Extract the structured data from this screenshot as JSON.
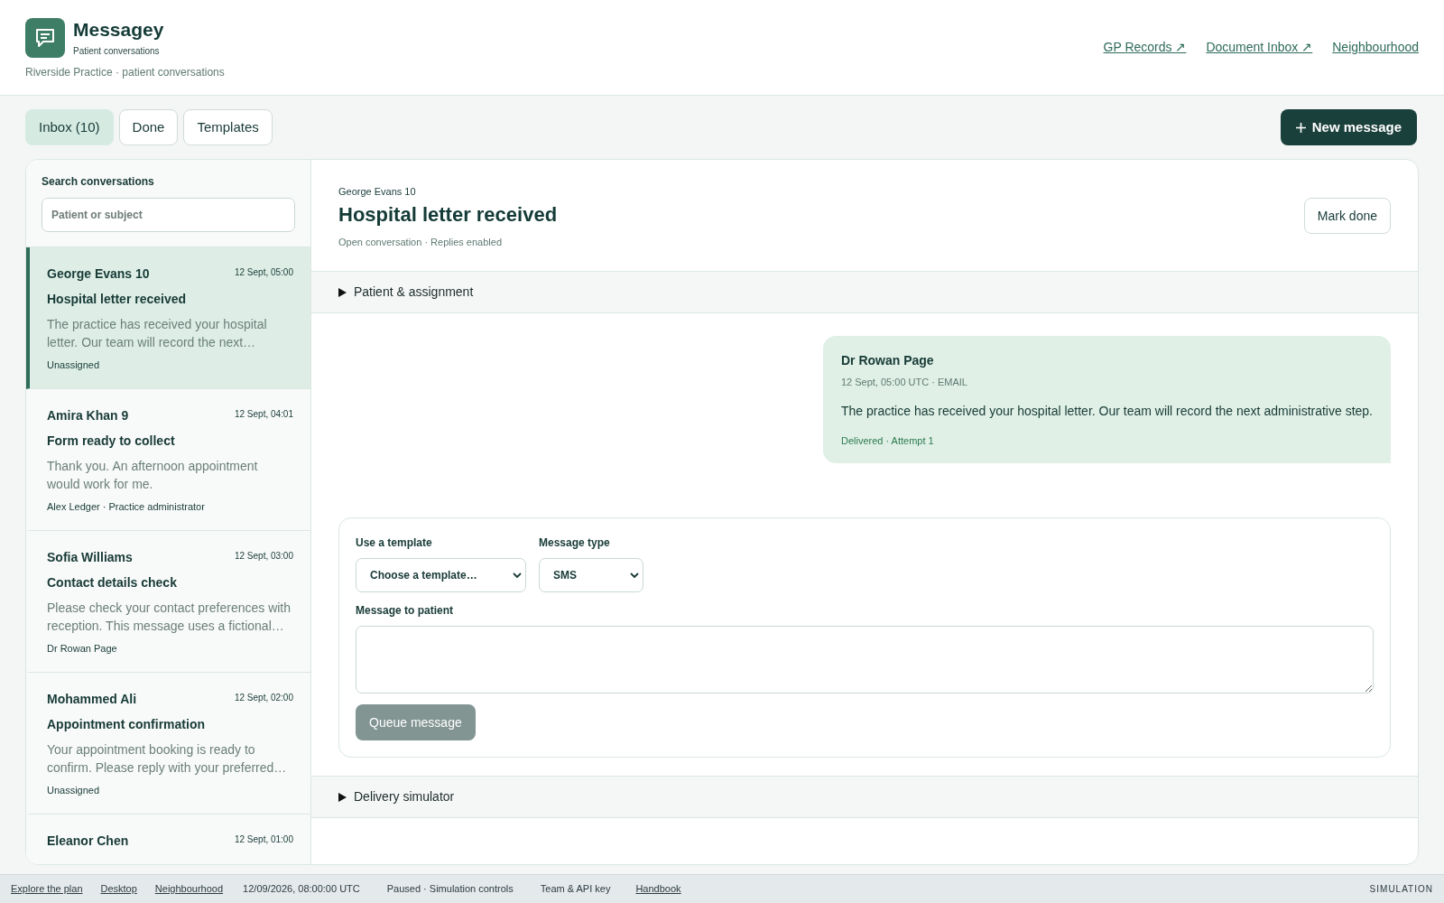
{
  "app": {
    "name": "Messagey",
    "tagline": "Patient conversations",
    "practice": "Riverside Practice · patient conversations"
  },
  "header_links": [
    "GP Records ↗",
    "Document Inbox ↗",
    "Neighbourhood"
  ],
  "tabs": [
    {
      "label": "Inbox (10)",
      "selected": true
    },
    {
      "label": "Done",
      "selected": false
    },
    {
      "label": "Templates",
      "selected": false
    }
  ],
  "new_message_button": "New message",
  "search": {
    "label": "Search conversations",
    "placeholder": "Patient or subject"
  },
  "conversations": [
    {
      "patient": "George Evans 10",
      "time": "12 Sept, 05:00",
      "subject": "Hospital letter received",
      "preview": "The practice has received your hospital letter. Our team will record the next…",
      "assignee": "Unassigned",
      "selected": true
    },
    {
      "patient": "Amira Khan 9",
      "time": "12 Sept, 04:01",
      "subject": "Form ready to collect",
      "preview": "Thank you. An afternoon appointment would work for me.",
      "assignee": "Alex Ledger · Practice administrator",
      "selected": false
    },
    {
      "patient": "Sofia Williams",
      "time": "12 Sept, 03:00",
      "subject": "Contact details check",
      "preview": "Please check your contact preferences with reception. This message uses a fictional…",
      "assignee": "Dr Rowan Page",
      "selected": false
    },
    {
      "patient": "Mohammed Ali",
      "time": "12 Sept, 02:00",
      "subject": "Appointment confirmation",
      "preview": "Your appointment booking is ready to confirm. Please reply with your preferred…",
      "assignee": "Unassigned",
      "selected": false
    },
    {
      "patient": "Eleanor Chen",
      "time": "12 Sept, 01:00",
      "selected": false
    }
  ],
  "conversation": {
    "patient": "George Evans 10",
    "title": "Hospital letter received",
    "status": "Open conversation · Replies enabled",
    "mark_done_button": "Mark done"
  },
  "patient_section": {
    "label": "Patient & assignment",
    "expanded": false
  },
  "messages": [
    {
      "sender": "Dr Rowan Page",
      "meta": "12 Sept, 05:00 UTC · EMAIL",
      "body": "The practice has received your hospital letter. Our team will record the next administrative step.",
      "status": "Delivered · Attempt 1"
    }
  ],
  "composer": {
    "template_label": "Use a template",
    "template_value": "Choose a template…",
    "type_label": "Message type",
    "type_value": "SMS",
    "message_label": "Message to patient",
    "send_button": {
      "label": "Queue message",
      "disabled": true
    }
  },
  "delivery_section": {
    "label": "Delivery simulator",
    "expanded": false
  },
  "footer": [
    {
      "kind": "link",
      "text": "Explore the plan"
    },
    {
      "kind": "link",
      "text": "Desktop"
    },
    {
      "kind": "link",
      "text": "Neighbourhood"
    },
    {
      "kind": "text",
      "text": "12/09/2026, 08:00:00 UTC"
    },
    {
      "kind": "text",
      "text": "Paused · Simulation controls"
    },
    {
      "kind": "text",
      "text": "Team & API key"
    },
    {
      "kind": "link",
      "text": "Handbook"
    }
  ],
  "footer_mode": "SIMULATION"
}
